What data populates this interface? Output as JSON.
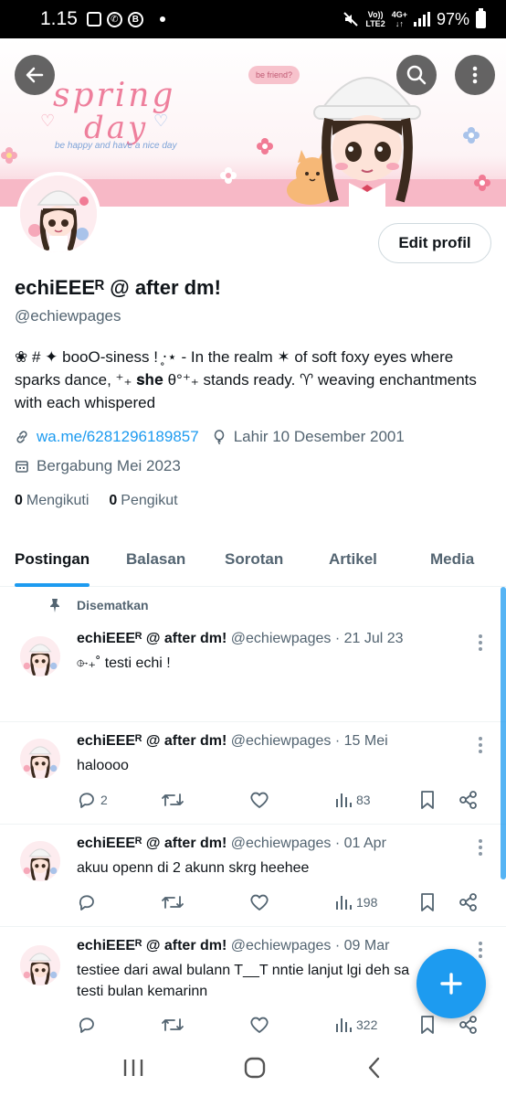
{
  "status_bar": {
    "time": "1.15",
    "network_top": "Vo))",
    "network_bottom": "LTE2",
    "data_top": "4G+",
    "battery": "97%"
  },
  "banner": {
    "title_line1": "spring",
    "title_line2": "day",
    "tagline": "be happy and have a nice day",
    "bubble": "be friend?"
  },
  "profile": {
    "name": "echiEEEᴿ @ after dm!",
    "handle": "@echiewpages",
    "bio": "❀ # ✦ booO-siness ! ̥‧⋆ -  In the realm ✶ of soft foxy eyes where sparks dance, ⁺₊ 𝐬𝐡𝐞 θ°⁺₊ stands ready. ♈ weaving enchantments with each whispered",
    "link": "wa.me/6281296189857",
    "birthday": "Lahir 10 Desember 2001",
    "joined": "Bergabung Mei 2023",
    "following_count": "0",
    "following_label": "Mengikuti",
    "followers_count": "0",
    "followers_label": "Pengikut",
    "edit_label": "Edit profil"
  },
  "tabs": [
    "Postingan",
    "Balasan",
    "Sorotan",
    "Artikel",
    "Media"
  ],
  "pinned_label": "Disematkan",
  "posts": [
    {
      "name": "echiEEEᴿ @ after dm!",
      "meta": "@echiewpages · 21 Jul 23",
      "text": "⌱₊˚ testi echi !",
      "replies": "",
      "views": ""
    },
    {
      "name": "echiEEEᴿ @ after dm!",
      "meta": "@echiewpages · 15 Mei",
      "text": "haloooo",
      "replies": "2",
      "views": "83"
    },
    {
      "name": "echiEEEᴿ @ after dm!",
      "meta": "@echiewpages · 01 Apr",
      "text": "akuu openn di 2 akunn skrg heehee",
      "replies": "",
      "views": "198"
    },
    {
      "name": "echiEEEᴿ @ after dm!",
      "meta": "@echiewpages · 09 Mar",
      "text": "testiee dari awal bulann T__T nntie lanjut lgi deh sa testi bulan kemarinn",
      "replies": "",
      "views": "322"
    }
  ],
  "colors": {
    "accent": "#1d9bf0",
    "text": "#0f1419",
    "secondary": "#536471",
    "banner_pink": "#ee7f9c"
  }
}
